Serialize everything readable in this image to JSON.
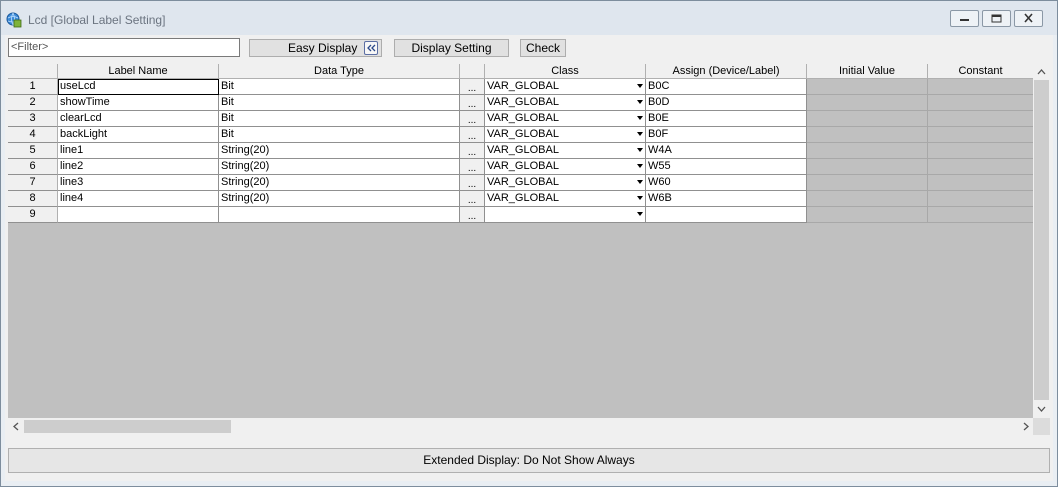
{
  "window": {
    "title": "Lcd [Global Label Setting]"
  },
  "toolbar": {
    "filter_placeholder": "<Filter>",
    "easy_display": "Easy Display",
    "display_setting": "Display Setting",
    "check": "Check"
  },
  "table": {
    "columns": [
      "Label Name",
      "Data Type",
      "Class",
      "Assign (Device/Label)",
      "Initial Value",
      "Constant"
    ],
    "rows": [
      {
        "num": "1",
        "label": "useLcd",
        "type": "Bit",
        "class": "VAR_GLOBAL",
        "assign": "B0C"
      },
      {
        "num": "2",
        "label": "showTime",
        "type": "Bit",
        "class": "VAR_GLOBAL",
        "assign": "B0D"
      },
      {
        "num": "3",
        "label": "clearLcd",
        "type": "Bit",
        "class": "VAR_GLOBAL",
        "assign": "B0E"
      },
      {
        "num": "4",
        "label": "backLight",
        "type": "Bit",
        "class": "VAR_GLOBAL",
        "assign": "B0F"
      },
      {
        "num": "5",
        "label": "line1",
        "type": "String(20)",
        "class": "VAR_GLOBAL",
        "assign": "W4A"
      },
      {
        "num": "6",
        "label": "line2",
        "type": "String(20)",
        "class": "VAR_GLOBAL",
        "assign": "W55"
      },
      {
        "num": "7",
        "label": "line3",
        "type": "String(20)",
        "class": "VAR_GLOBAL",
        "assign": "W60"
      },
      {
        "num": "8",
        "label": "line4",
        "type": "String(20)",
        "class": "VAR_GLOBAL",
        "assign": "W6B"
      },
      {
        "num": "9",
        "label": "",
        "type": "",
        "class": "",
        "assign": ""
      }
    ],
    "browse_button": "..."
  },
  "footer": {
    "extended_display": "Extended Display: Do Not Show Always"
  }
}
